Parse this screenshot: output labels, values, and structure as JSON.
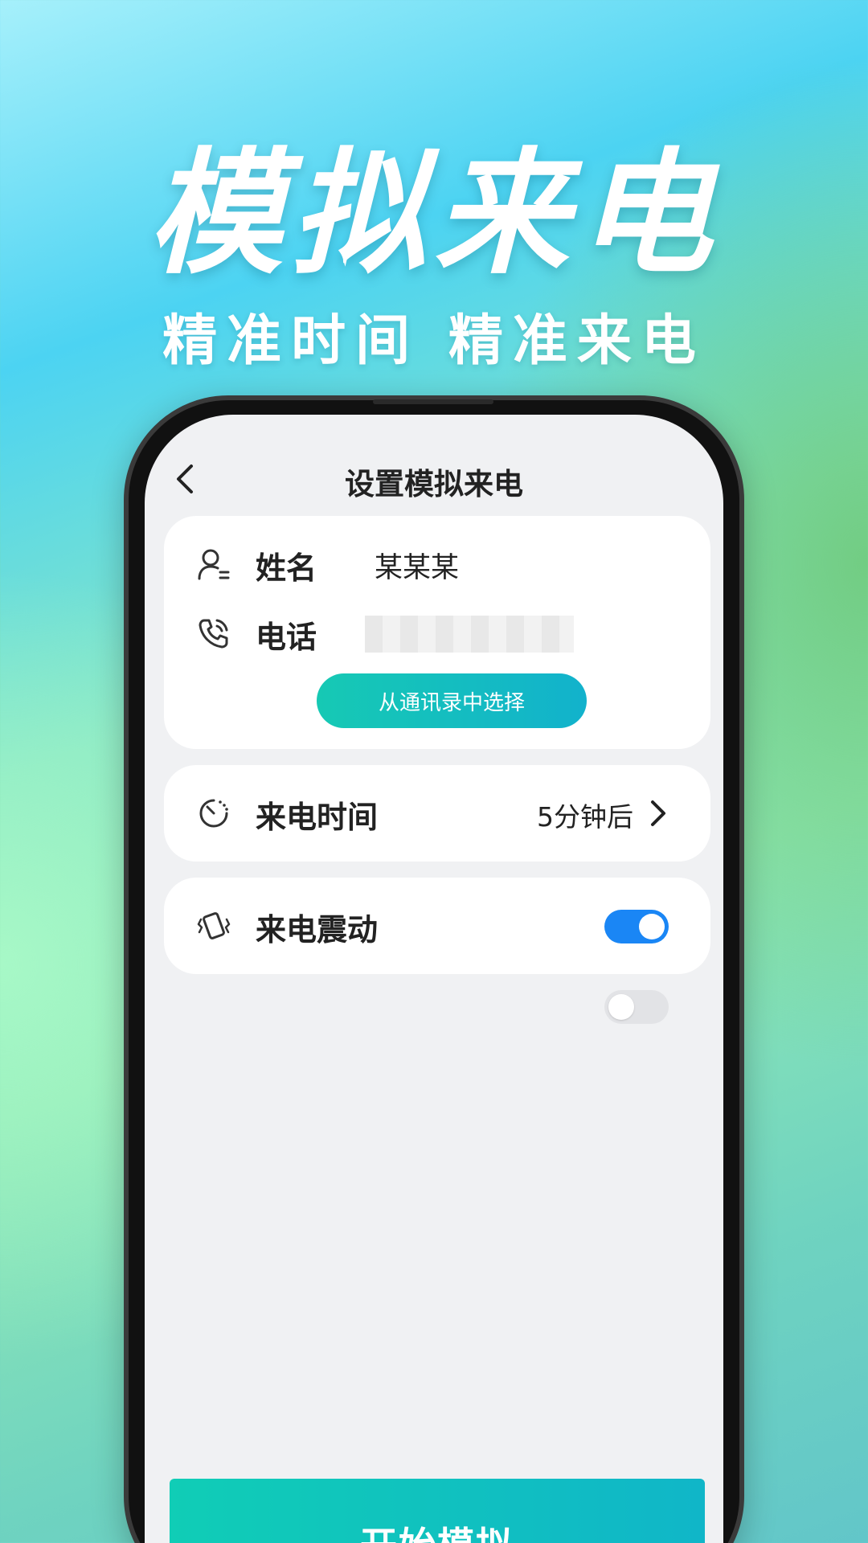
{
  "promo": {
    "headline": "模拟来电",
    "subline": "精准时间 精准来电"
  },
  "header": {
    "title": "设置模拟来电"
  },
  "contact": {
    "name_label": "姓名",
    "name_value": "某某某",
    "phone_label": "电话",
    "phone_value": "",
    "pick_button_label": "从通讯录中选择"
  },
  "call_time": {
    "label": "来电时间",
    "value": "5分钟后"
  },
  "vibrate": {
    "label": "来电震动",
    "enabled": true
  },
  "extra_toggle": {
    "enabled": false
  },
  "start_button": {
    "label": "开始模拟"
  },
  "colors": {
    "accent_gradient_start": "#16c9b4",
    "accent_gradient_end": "#12b2cc",
    "toggle_on": "#1a86f5",
    "toggle_off": "#e2e3e6"
  }
}
